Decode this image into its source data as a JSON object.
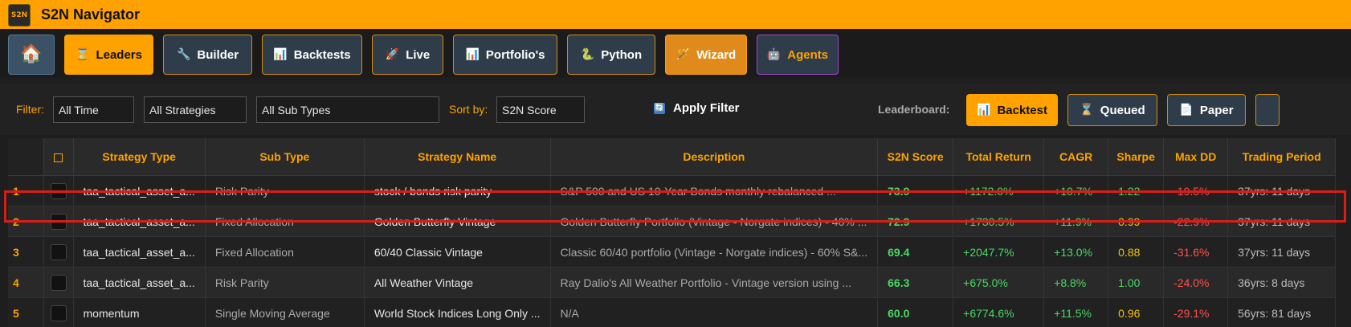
{
  "app": {
    "title": "S2N Navigator",
    "logo_text": "S2N"
  },
  "nav": {
    "home_icon": "🏠",
    "items": [
      {
        "label": "Leaders",
        "icon": "⌛"
      },
      {
        "label": "Builder",
        "icon": "🔧"
      },
      {
        "label": "Backtests",
        "icon": "📊"
      },
      {
        "label": "Live",
        "icon": "🚀"
      },
      {
        "label": "Portfolio's",
        "icon": "📊"
      },
      {
        "label": "Python",
        "icon": "🐍"
      },
      {
        "label": "Wizard",
        "icon": "🪄"
      },
      {
        "label": "Agents",
        "icon": "🤖"
      }
    ]
  },
  "filters": {
    "filter_label": "Filter:",
    "time": "All Time",
    "strategies": "All Strategies",
    "sub_types": "All Sub Types",
    "sort_label": "Sort by:",
    "sort": "S2N Score",
    "apply_label": "Apply Filter",
    "apply_icon": "🔄"
  },
  "leaderboard": {
    "label": "Leaderboard:",
    "buttons": [
      {
        "label": "Backtest",
        "icon": "📊"
      },
      {
        "label": "Queued",
        "icon": "⌛"
      },
      {
        "label": "Paper",
        "icon": "📄"
      }
    ]
  },
  "table": {
    "headers": [
      "Strategy Type",
      "Sub Type",
      "Strategy Name",
      "Description",
      "S2N Score",
      "Total Return",
      "CAGR",
      "Sharpe",
      "Max DD",
      "Trading Period"
    ],
    "rows": [
      {
        "rank": "1",
        "type": "taa_tactical_asset_a...",
        "sub": "Risk Parity",
        "name": "stock / bonds risk parity",
        "desc": "S&P 500 and US 10-Year Bonds monthly rebalanced ...",
        "score": "73.9",
        "ret": "+1172.0%",
        "cagr": "+10.7%",
        "sharpe": "1.22",
        "dd": "-19.5%",
        "period": "37yrs: 11 days"
      },
      {
        "rank": "2",
        "type": "taa_tactical_asset_a...",
        "sub": "Fixed Allocation",
        "name": "Golden Butterfly Vintage",
        "desc": "Golden Butterfly Portfolio (Vintage - Norgate indices) - 40% ...",
        "score": "72.9",
        "ret": "+1730.5%",
        "cagr": "+11.9%",
        "sharpe": "0.99",
        "dd": "-22.9%",
        "period": "37yrs: 11 days"
      },
      {
        "rank": "3",
        "type": "taa_tactical_asset_a...",
        "sub": "Fixed Allocation",
        "name": "60/40 Classic Vintage",
        "desc": "Classic 60/40 portfolio (Vintage - Norgate indices) - 60% S&...",
        "score": "69.4",
        "ret": "+2047.7%",
        "cagr": "+13.0%",
        "sharpe": "0.88",
        "dd": "-31.6%",
        "period": "37yrs: 11 days"
      },
      {
        "rank": "4",
        "type": "taa_tactical_asset_a...",
        "sub": "Risk Parity",
        "name": "All Weather Vintage",
        "desc": "Ray Dalio's All Weather Portfolio - Vintage version using ...",
        "score": "66.3",
        "ret": "+675.0%",
        "cagr": "+8.8%",
        "sharpe": "1.00",
        "dd": "-24.0%",
        "period": "36yrs: 8 days"
      },
      {
        "rank": "5",
        "type": "momentum",
        "sub": "Single Moving Average",
        "name": "World Stock Indices Long Only ...",
        "desc": "N/A",
        "score": "60.0",
        "ret": "+6774.6%",
        "cagr": "+11.5%",
        "sharpe": "0.96",
        "dd": "-29.1%",
        "period": "56yrs: 81 days"
      }
    ]
  },
  "colors": {
    "accent": "#ffa200",
    "positive": "#4ad864",
    "neutral": "#f1c40f",
    "negative": "#ff5050",
    "highlight": "#d91e18"
  }
}
